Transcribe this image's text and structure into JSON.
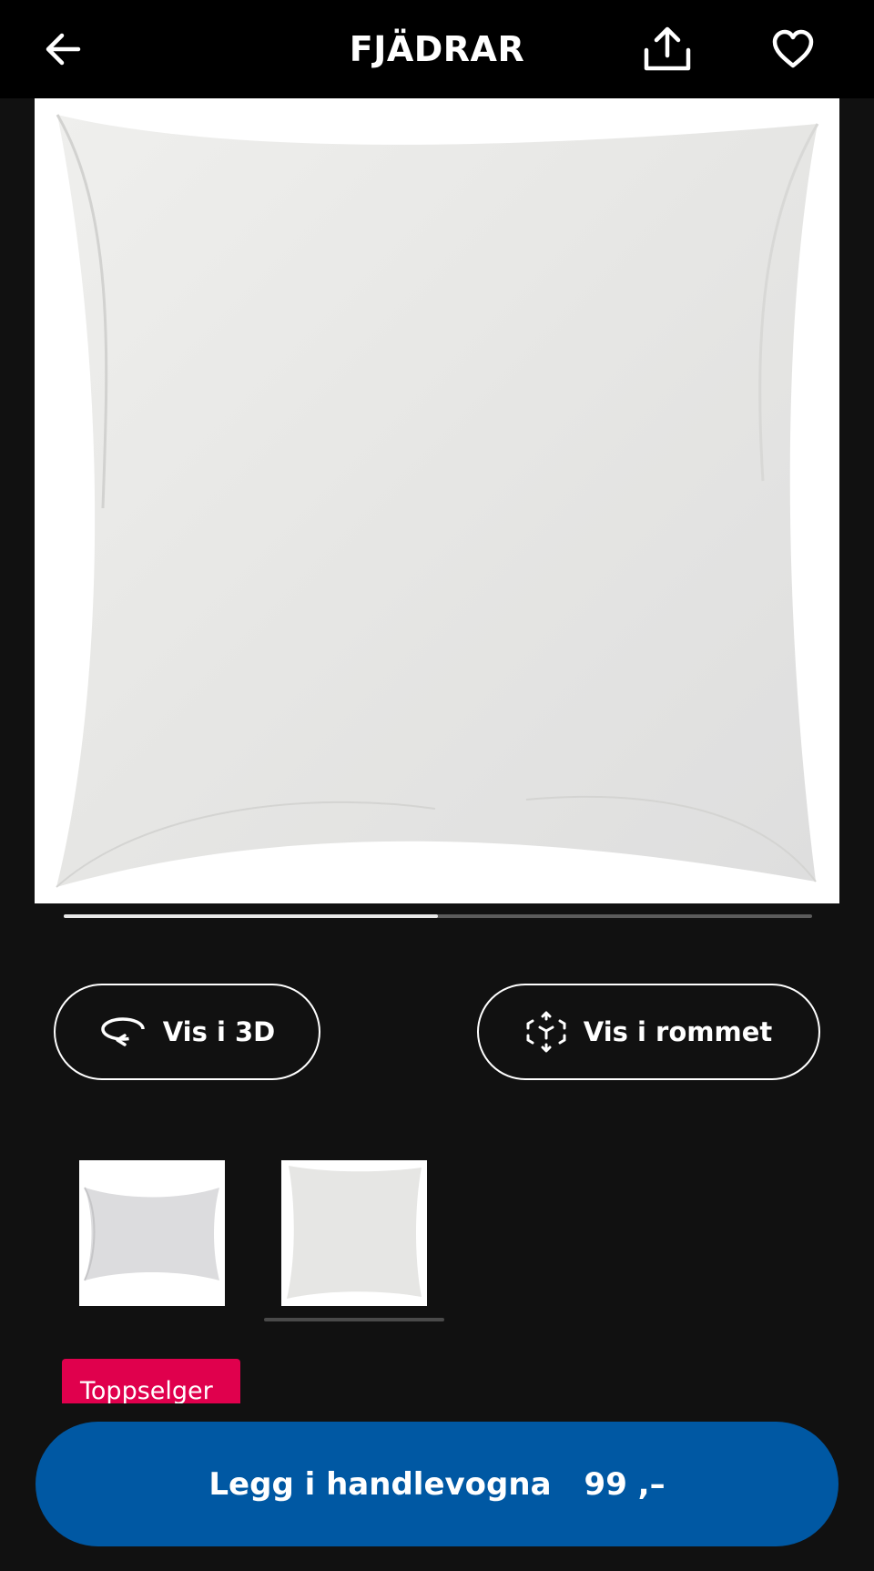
{
  "header": {
    "title": "FJÄDRAR",
    "back_icon": "arrow-left-icon",
    "share_icon": "share-upload-icon",
    "favorite_icon": "heart-outline-icon"
  },
  "gallery": {
    "image_alt": "Hvit pute",
    "progress_fraction": 0.5
  },
  "actions": {
    "view_3d_label": "Vis i 3D",
    "view_3d_icon": "rotate-3d-icon",
    "view_room_label": "Vis i rommet",
    "view_room_icon": "ar-cube-icon"
  },
  "thumbnails": [
    {
      "name": "rectangular-pillow",
      "selected": false
    },
    {
      "name": "square-pillow",
      "selected": true
    }
  ],
  "badge": {
    "label": "Toppselger",
    "color": "#e0004d"
  },
  "cta": {
    "label": "Legg i handlevogna",
    "price": "99 ,–",
    "color": "#0058a3"
  }
}
